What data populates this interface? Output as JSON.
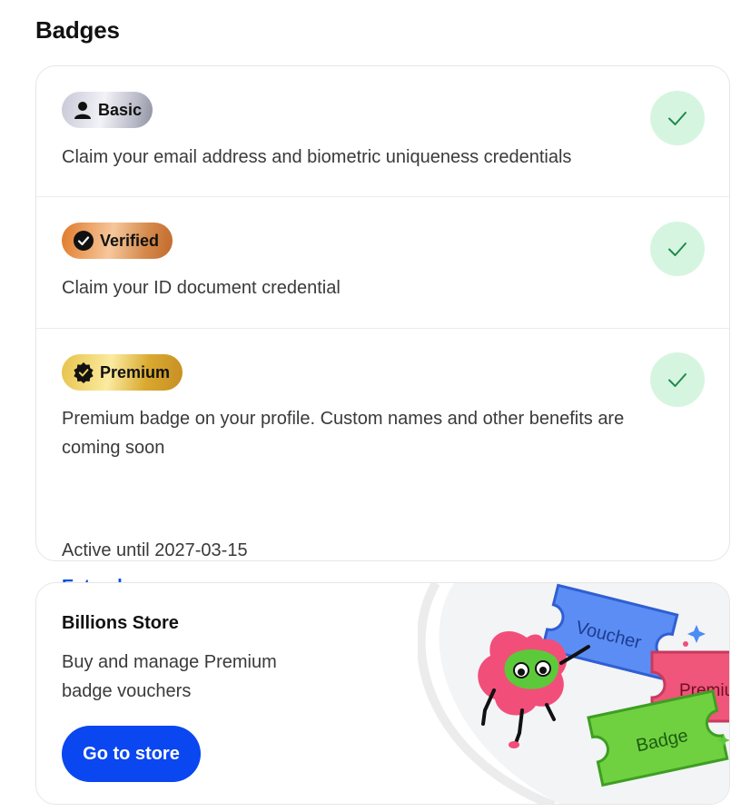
{
  "page": {
    "title": "Badges"
  },
  "badges": [
    {
      "label": "Basic",
      "icon": "person-icon",
      "description": "Claim your email address and biometric uniqueness credentials",
      "status": "completed"
    },
    {
      "label": "Verified",
      "icon": "check-circle-icon",
      "description": "Claim your ID document credential",
      "status": "completed"
    },
    {
      "label": "Premium",
      "icon": "verified-seal-icon",
      "description": "Premium badge on your profile. Custom names and other benefits are coming soon",
      "active_until": "Active until 2027-03-15",
      "action_label": "Extend",
      "status": "completed"
    }
  ],
  "store": {
    "title": "Billions Store",
    "description": "Buy and manage Premium badge vouchers",
    "button_label": "Go to store",
    "illustration": {
      "ticket_labels": [
        "Voucher",
        "Premium",
        "Badge"
      ]
    }
  },
  "colors": {
    "check_bg": "#d6f5e0",
    "check_mark": "#1f8a4c",
    "link": "#0a4fe0",
    "button": "#0a47f0"
  }
}
